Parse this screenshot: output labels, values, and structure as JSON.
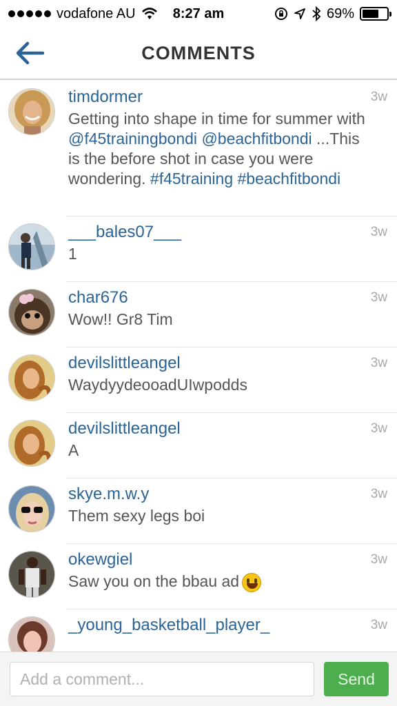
{
  "status_bar": {
    "carrier": "vodafone AU",
    "time": "8:27 am",
    "battery_percent": "69%",
    "battery_level": 0.69,
    "icons": [
      "signal-dots-icon",
      "wifi-icon",
      "rotation-lock-icon",
      "location-icon",
      "bluetooth-icon",
      "battery-icon"
    ]
  },
  "header": {
    "title": "COMMENTS",
    "back_icon": "back-arrow-icon"
  },
  "comments": [
    {
      "username": "timdormer",
      "time": "3w",
      "text_parts": [
        {
          "t": "Getting into shape in time for summer with ",
          "link": false
        },
        {
          "t": "@f45trainingbondi",
          "link": true
        },
        {
          "t": " ",
          "link": false
        },
        {
          "t": "@beachfitbondi",
          "link": true
        },
        {
          "t": " ...This is the before shot in case you were wondering. ",
          "link": false
        },
        {
          "t": "#f45training",
          "link": true
        },
        {
          "t": " ",
          "link": false
        },
        {
          "t": "#beachfitbondi",
          "link": true
        }
      ]
    },
    {
      "username": "___bales07___",
      "time": "3w",
      "text": "1"
    },
    {
      "username": "char676",
      "time": "3w",
      "text": "Wow!! Gr8 Tim"
    },
    {
      "username": "devilslittleangel",
      "time": "3w",
      "text": "WaydyydeooadUIwpodds"
    },
    {
      "username": "devilslittleangel",
      "time": "3w",
      "text": "A"
    },
    {
      "username": "skye.m.w.y",
      "time": "3w",
      "text": "Them sexy legs boi"
    },
    {
      "username": "okewgiel",
      "time": "3w",
      "text": "Saw you on the bbau ad",
      "emoji": "smiley-emoji-icon"
    },
    {
      "username": "_young_basketball_player_",
      "time": "3w",
      "text": ""
    }
  ],
  "input": {
    "placeholder": "Add a comment...",
    "value": "",
    "send_label": "Send"
  },
  "colors": {
    "link": "#2a6496",
    "send": "#4cae4c",
    "timestamp": "#a8a8a8"
  }
}
